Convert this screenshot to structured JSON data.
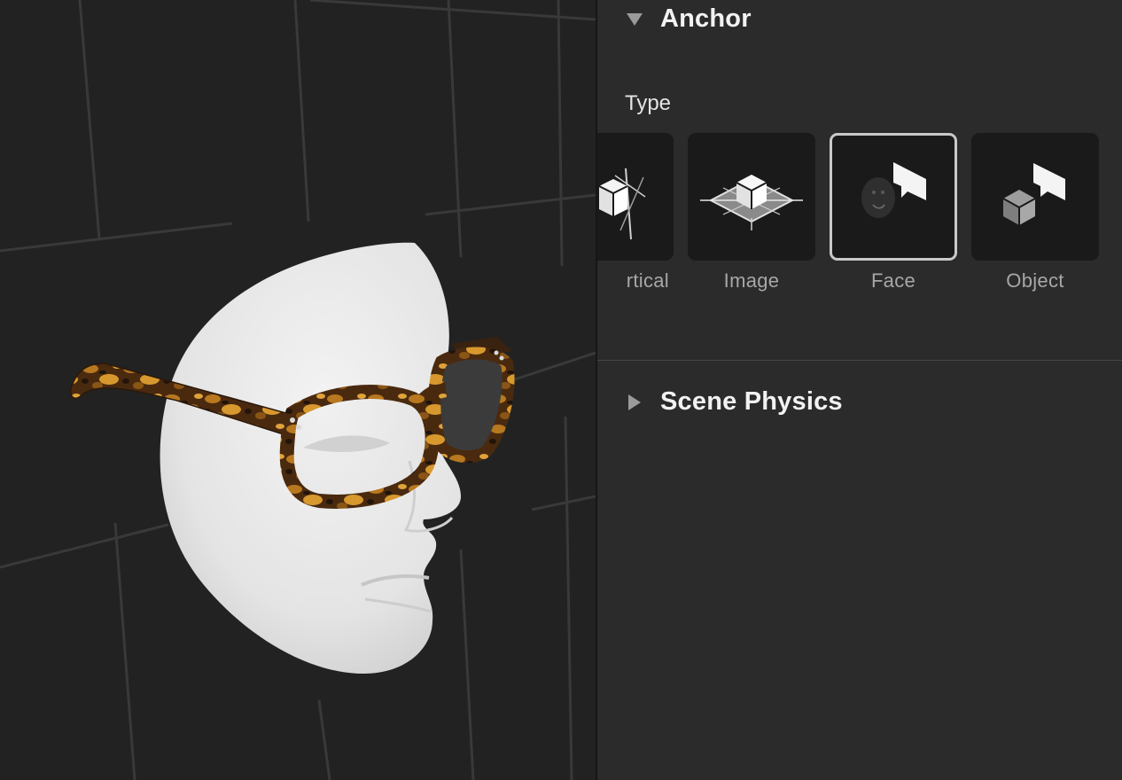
{
  "anchor_section": {
    "title": "Anchor",
    "expanded": true,
    "type_label": "Type",
    "selected_type": "Face",
    "types": [
      {
        "label": "Vertical",
        "visible_text": "rtical",
        "icon": "vertical-plane-icon"
      },
      {
        "label": "Image",
        "visible_text": "Image",
        "icon": "image-anchor-icon"
      },
      {
        "label": "Face",
        "visible_text": "Face",
        "icon": "face-anchor-icon"
      },
      {
        "label": "Object",
        "visible_text": "Object",
        "icon": "object-anchor-icon"
      }
    ]
  },
  "physics_section": {
    "title": "Scene Physics",
    "expanded": false
  },
  "viewport": {
    "scene": "face mask with tortoiseshell glasses",
    "colors": {
      "background": "#222222",
      "mask": "#e6e6e6",
      "frame": "#6b3f16",
      "frame_highlight": "#c98a2c",
      "grid": "#3a3a3a"
    }
  },
  "colors": {
    "inspector_bg": "#2b2b2b",
    "tile_bg": "#1a1a1a",
    "selected_border": "#c9c9c9",
    "title_text": "#f2f2f2",
    "label_text": "#a7a7a7"
  }
}
